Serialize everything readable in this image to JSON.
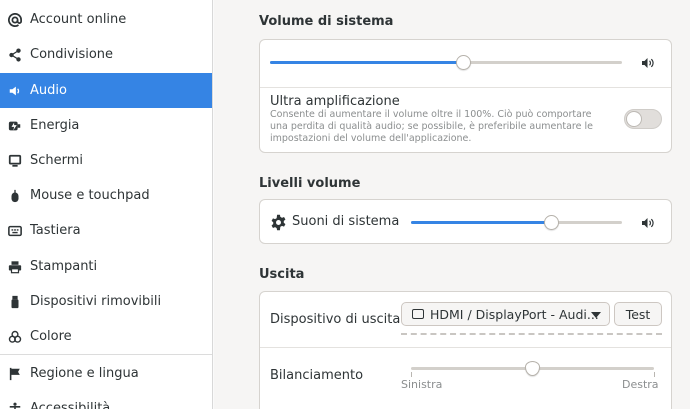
{
  "sidebar": {
    "items": [
      {
        "label": "Account online",
        "icon": "at-icon",
        "active": false
      },
      {
        "label": "Condivisione",
        "icon": "share-icon",
        "active": false
      },
      {
        "label": "Audio",
        "icon": "speaker-icon",
        "active": true
      },
      {
        "label": "Energia",
        "icon": "power-icon",
        "active": false
      },
      {
        "label": "Schermi",
        "icon": "display-icon",
        "active": false
      },
      {
        "label": "Mouse e touchpad",
        "icon": "mouse-icon",
        "active": false
      },
      {
        "label": "Tastiera",
        "icon": "keyboard-icon",
        "active": false
      },
      {
        "label": "Stampanti",
        "icon": "printer-icon",
        "active": false
      },
      {
        "label": "Dispositivi rimovibili",
        "icon": "usb-icon",
        "active": false
      },
      {
        "label": "Colore",
        "icon": "palette-icon",
        "active": false
      },
      {
        "label": "Regione e lingua",
        "icon": "flag-icon",
        "active": false
      },
      {
        "label": "Accessibilità",
        "icon": "accessibility-icon",
        "active": false
      }
    ]
  },
  "system_volume": {
    "title": "Volume di sistema",
    "level": 0.55,
    "boost_label": "Ultra amplificazione",
    "boost_description": "Consente di aumentare il volume oltre il 100%. Ciò può comportare una perdita di qualità audio; se possibile, è preferibile aumentare le impostazioni del volume dell'applicazione.",
    "boost_enabled": false
  },
  "volume_levels": {
    "title": "Livelli volume",
    "system_sounds_label": "Suoni di sistema",
    "system_sounds_level": 0.67
  },
  "output": {
    "title": "Uscita",
    "device_label": "Dispositivo di uscita",
    "device_value": "HDMI / DisplayPort - Audi...",
    "test_label": "Test",
    "balance_label": "Bilanciamento",
    "balance_left": "Sinistra",
    "balance_right": "Destra",
    "balance_value": 0.5
  },
  "colors": {
    "accent": "#3584e4",
    "track": "#d3d0cb"
  }
}
